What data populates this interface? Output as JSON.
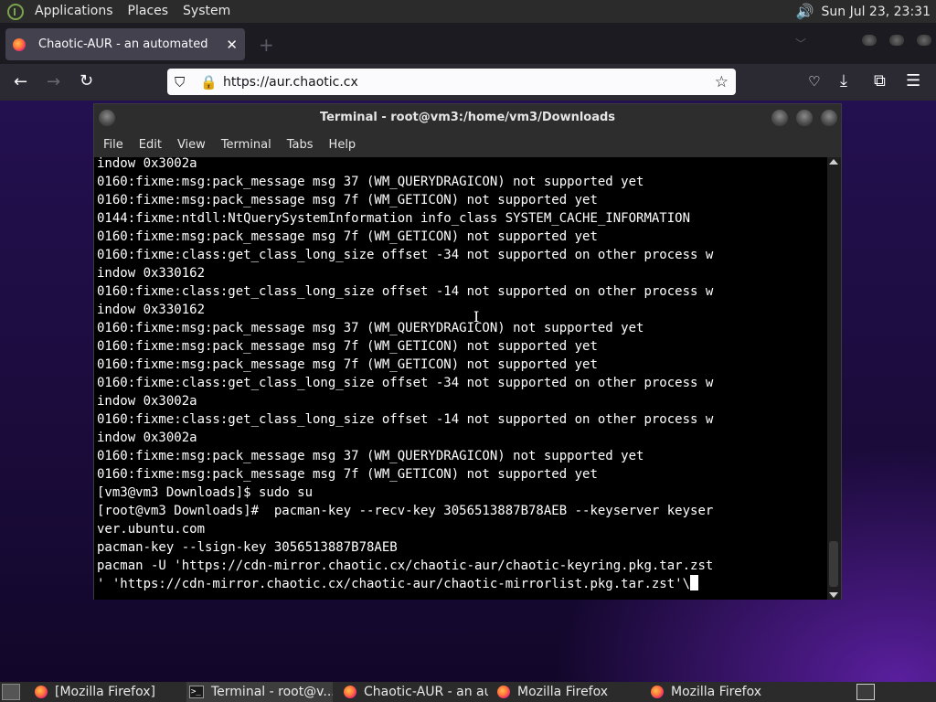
{
  "top_panel": {
    "menus": [
      "Applications",
      "Places",
      "System"
    ],
    "clock": "Sun Jul 23, 23:31"
  },
  "browser": {
    "tab_title": "Chaotic-AUR - an automated bu",
    "url": "https://aur.chaotic.cx"
  },
  "terminal": {
    "title": "Terminal - root@vm3:/home/vm3/Downloads",
    "menus": [
      "File",
      "Edit",
      "View",
      "Terminal",
      "Tabs",
      "Help"
    ],
    "lines": [
      "indow 0x3002a",
      "0160:fixme:msg:pack_message msg 37 (WM_QUERYDRAGICON) not supported yet",
      "0160:fixme:msg:pack_message msg 7f (WM_GETICON) not supported yet",
      "0144:fixme:ntdll:NtQuerySystemInformation info_class SYSTEM_CACHE_INFORMATION",
      "0160:fixme:msg:pack_message msg 7f (WM_GETICON) not supported yet",
      "0160:fixme:class:get_class_long_size offset -34 not supported on other process w",
      "indow 0x330162",
      "0160:fixme:class:get_class_long_size offset -14 not supported on other process w",
      "indow 0x330162",
      "0160:fixme:msg:pack_message msg 37 (WM_QUERYDRAGICON) not supported yet",
      "0160:fixme:msg:pack_message msg 7f (WM_GETICON) not supported yet",
      "0160:fixme:msg:pack_message msg 7f (WM_GETICON) not supported yet",
      "0160:fixme:class:get_class_long_size offset -34 not supported on other process w",
      "indow 0x3002a",
      "0160:fixme:class:get_class_long_size offset -14 not supported on other process w",
      "indow 0x3002a",
      "0160:fixme:msg:pack_message msg 37 (WM_QUERYDRAGICON) not supported yet",
      "0160:fixme:msg:pack_message msg 7f (WM_GETICON) not supported yet",
      "[vm3@vm3 Downloads]$ sudo su",
      "[root@vm3 Downloads]#  pacman-key --recv-key 3056513887B78AEB --keyserver keyser",
      "ver.ubuntu.com",
      "pacman-key --lsign-key 3056513887B78AEB",
      "pacman -U 'https://cdn-mirror.chaotic.cx/chaotic-aur/chaotic-keyring.pkg.tar.zst",
      "' 'https://cdn-mirror.chaotic.cx/chaotic-aur/chaotic-mirrorlist.pkg.tar.zst'\\"
    ]
  },
  "taskbar": {
    "tasks": [
      {
        "label": "[Mozilla Firefox]",
        "icon": "firefox-icon"
      },
      {
        "label": "Terminal - root@v...",
        "icon": "terminal-icon"
      },
      {
        "label": "Chaotic-AUR - an au...",
        "icon": "firefox-icon"
      },
      {
        "label": "Mozilla Firefox",
        "icon": "firefox-icon"
      },
      {
        "label": "Mozilla Firefox",
        "icon": "firefox-icon"
      }
    ]
  },
  "colors": {
    "terminal_bg": "#000000",
    "terminal_fg": "#ffffff",
    "page_bg": "#1a0b3a",
    "panel_bg": "#2b2b2b"
  }
}
